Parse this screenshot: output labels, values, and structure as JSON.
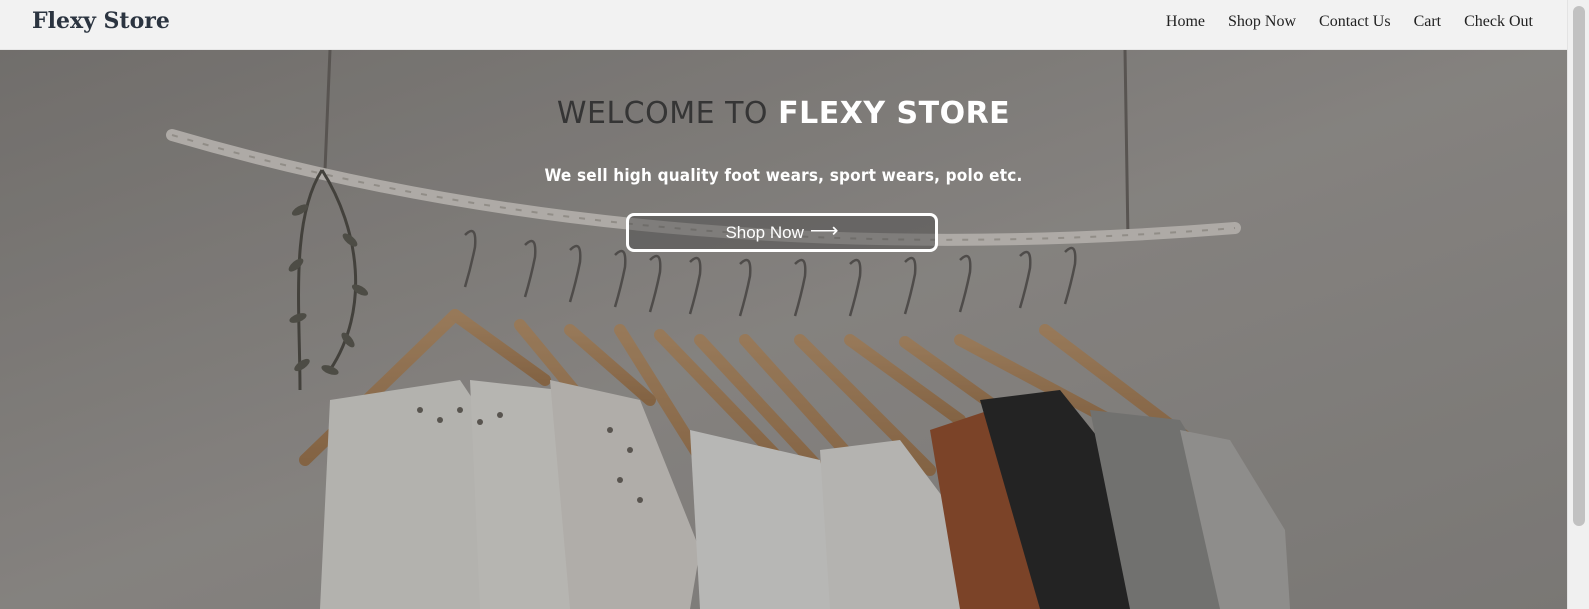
{
  "brand": "Flexy Store",
  "nav": {
    "home": "Home",
    "shop_now": "Shop Now",
    "contact_us": "Contact Us",
    "cart": "Cart",
    "check_out": "Check Out"
  },
  "hero": {
    "title_prefix": "WELCOME TO",
    "title_highlight": "FLEXY STORE",
    "subtitle": "We sell high quality foot wears, sport wears, polo etc.",
    "cta_label": "Shop Now",
    "cta_icon": "arrow-right-icon",
    "background": "clothes-on-hangers-image"
  },
  "colors": {
    "navbar_bg": "#f2f2f2",
    "brand_text": "#2b3440",
    "title_dark": "#353535",
    "title_light": "#ffffff",
    "overlay": "rgba(45,45,45,0.30)"
  }
}
